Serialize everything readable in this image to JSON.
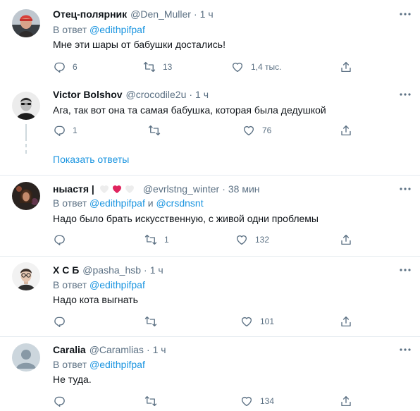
{
  "tweets": [
    {
      "name": "Отец-полярник",
      "handle": "@Den_Muller",
      "dot": "·",
      "time": "1 ч",
      "reply_prefix": "В ответ",
      "reply_to": "@edithpifpaf",
      "text": "Мне эти шары от бабушки достались!",
      "replies": "6",
      "retweets": "13",
      "likes": "1,4 тыс."
    },
    {
      "name": "Victor Bolshov",
      "handle": "@crocodile2u",
      "dot": "·",
      "time": "1 ч",
      "text": "Ага, так вот она та самая бабушка, которая была дедушкой",
      "replies": "1",
      "retweets": "",
      "likes": "76",
      "show_replies": "Показать ответы"
    },
    {
      "name": "ныастя |",
      "handle": "@evrlstng_winter",
      "dot": "·",
      "time": "38 мин",
      "reply_prefix": "В ответ",
      "reply_to": "@edithpifpaf",
      "reply_and": "и",
      "reply_to_2": "@crsdnsnt",
      "text": "Надо было брать искусственную, с живой одни проблемы",
      "replies": "",
      "retweets": "1",
      "likes": "132"
    },
    {
      "name": "Х С Б",
      "handle": "@pasha_hsb",
      "dot": "·",
      "time": "1 ч",
      "reply_prefix": "В ответ",
      "reply_to": "@edithpifpaf",
      "text": "Надо кота выгнать",
      "replies": "",
      "retweets": "",
      "likes": "101"
    },
    {
      "name": "Caralia",
      "handle": "@Caramlias",
      "dot": "·",
      "time": "1 ч",
      "reply_prefix": "В ответ",
      "reply_to": "@edithpifpaf",
      "text": "Не туда.",
      "replies": "",
      "retweets": "",
      "likes": "134"
    }
  ],
  "colors": {
    "text": "#0f1419",
    "secondary": "#5b7083",
    "link": "#1b95e0",
    "divider": "#e6ecf0",
    "heart": "#e0245e"
  },
  "icons": [
    "reply-icon",
    "retweet-icon",
    "like-icon",
    "share-icon",
    "more-icon",
    "heart-emoji-icon"
  ]
}
